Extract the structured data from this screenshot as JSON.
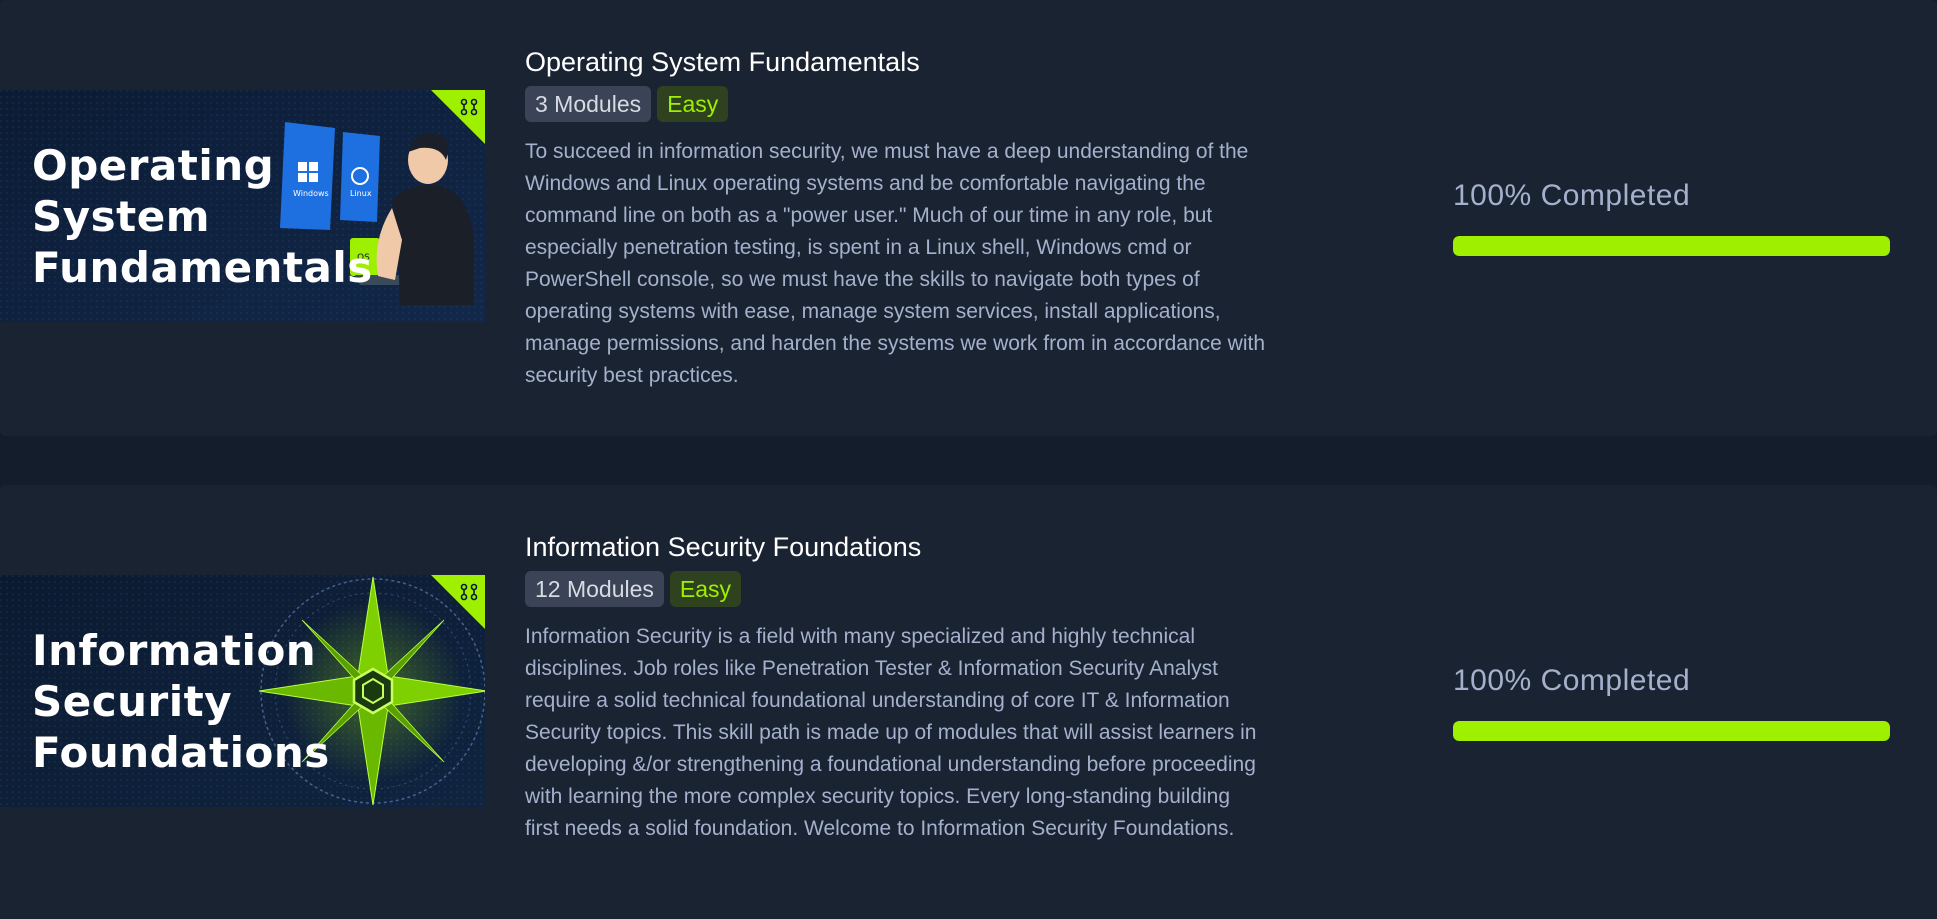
{
  "colors": {
    "accent": "#9fef00",
    "card_bg": "#1a2332",
    "page_bg": "#141d2b"
  },
  "paths": [
    {
      "thumbnail_title": "Operating\nSystem\nFundamentals",
      "thumbnail_labels": [
        "Windows",
        "Linux",
        "OS"
      ],
      "title": "Operating System Fundamentals",
      "modules": "3 Modules",
      "difficulty": "Easy",
      "description": "To succeed in information security, we must have a deep understanding of the Windows and Linux operating systems and be comfortable navigating the command line on both as a \"power user.\" Much of our time in any role, but especially penetration testing, is spent in a Linux shell, Windows cmd or PowerShell console, so we must have the skills to navigate both types of operating systems with ease, manage system services, install applications, manage permissions, and harden the systems we work from in accordance with security best practices.",
      "progress_label": "100% Completed",
      "progress": 1.0
    },
    {
      "thumbnail_title": "Information\nSecurity\nFoundations",
      "title": "Information Security Foundations",
      "modules": "12 Modules",
      "difficulty": "Easy",
      "description": "Information Security is a field with many specialized and highly technical disciplines. Job roles like Penetration Tester & Information Security Analyst require a solid technical foundational understanding of core IT & Information Security topics. This skill path is made up of modules that will assist learners in developing &/or strengthening a foundational understanding before proceeding with learning the more complex security topics. Every long-standing building first needs a solid foundation. Welcome to Information Security Foundations.",
      "progress_label": "100% Completed",
      "progress": 1.0
    }
  ]
}
